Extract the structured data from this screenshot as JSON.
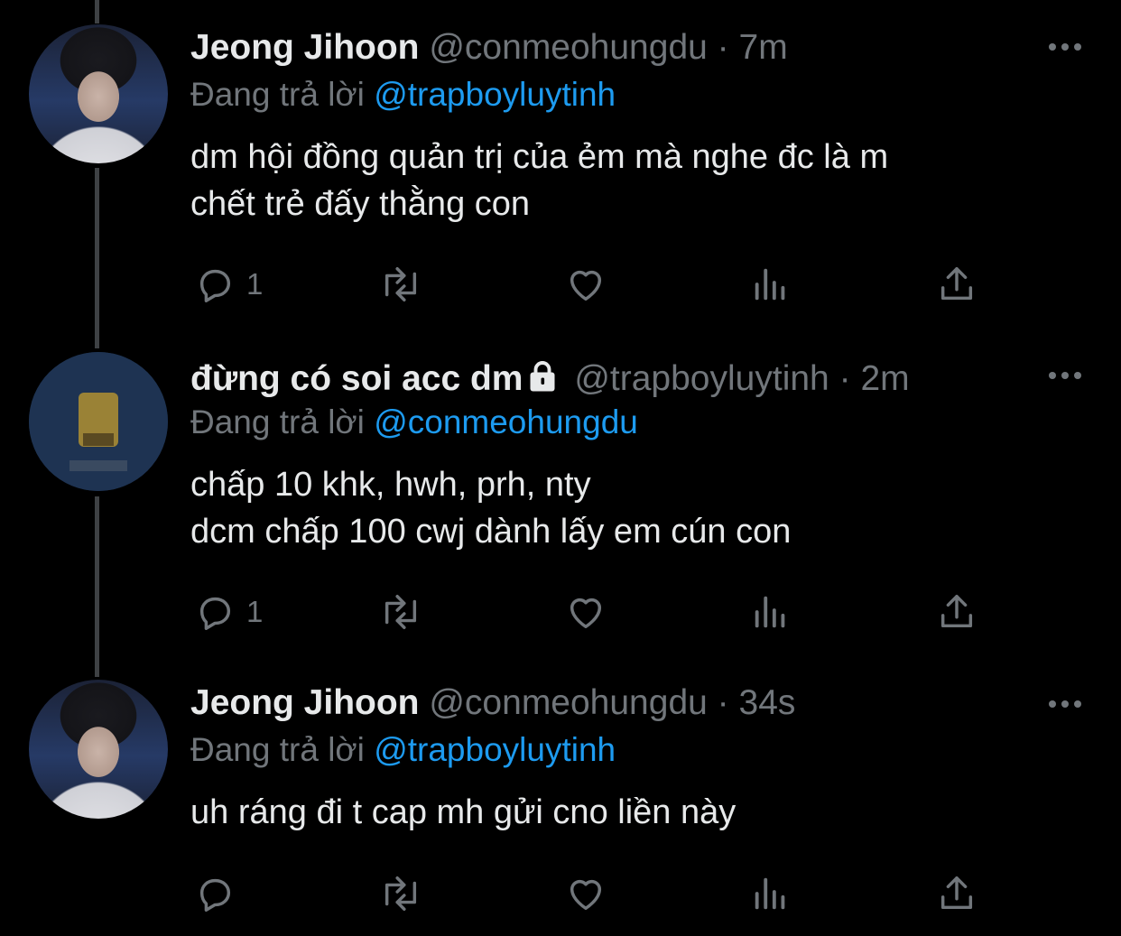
{
  "tweets": [
    {
      "display_name": "Jeong Jihoon",
      "handle": "@conmeohungdu",
      "dot": "·",
      "time": "7m",
      "reply_prefix": "Đang trả lời",
      "reply_to": "@trapboyluytinh",
      "text": "dm hội đồng quản trị của ẻm mà nghe đc là m\nchết trẻ đấy thằng con",
      "reply_count": "1",
      "locked": false,
      "avatar": "jihoon-avatar"
    },
    {
      "display_name": "đừng có soi acc dm",
      "handle": "@trapboyluytinh",
      "dot": "·",
      "time": "2m",
      "reply_prefix": "Đang trả lời",
      "reply_to": "@conmeohungdu",
      "text": "chấp 10 khk, hwh, prh, nty\ndcm chấp 100 cwj dành lấy em cún con",
      "reply_count": "1",
      "locked": true,
      "avatar": "spongebob-avatar"
    },
    {
      "display_name": "Jeong Jihoon",
      "handle": "@conmeohungdu",
      "dot": "·",
      "time": "34s",
      "reply_prefix": "Đang trả lời",
      "reply_to": "@trapboyluytinh",
      "text": "uh ráng đi t cap mh gửi cno liền này",
      "reply_count": "",
      "locked": false,
      "avatar": "jihoon-avatar"
    }
  ],
  "icons": {
    "reply": "reply-icon",
    "retweet": "retweet-icon",
    "like": "heart-icon",
    "views": "views-icon",
    "share": "share-icon",
    "more": "more-icon",
    "lock": "lock-icon"
  },
  "colors": {
    "background": "#000000",
    "text": "#e7e9ea",
    "secondary": "#71767b",
    "link": "#1d9bf0",
    "thread_line": "#3e4144"
  }
}
